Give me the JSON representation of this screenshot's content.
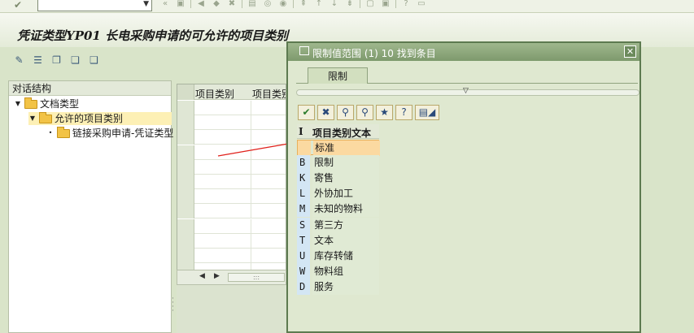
{
  "window": {
    "title": "凭证类型YP01 长电采购申请的可允许的项目类别"
  },
  "toolbar": {
    "command_field_value": "",
    "icons": [
      "check-icon",
      "save-icon",
      "back-icon",
      "exit-icon",
      "cancel-icon",
      "print-icon",
      "find-icon",
      "find-next-icon",
      "first-page-icon",
      "prev-page-icon",
      "next-page-icon",
      "last-page-icon",
      "new-session-icon",
      "shortcut-icon",
      "help-icon",
      "layout-icon"
    ]
  },
  "app_toolbar": {
    "icons": [
      "display-change-icon",
      "new-entries-icon",
      "copy-as-icon",
      "delete-icon",
      "select-all-icon"
    ]
  },
  "tree": {
    "header": "对话结构",
    "nodes": [
      {
        "label": "文档类型",
        "level": 0
      },
      {
        "label": "允许的项目类别",
        "level": 1
      },
      {
        "label": "链接采购申请-凭证类型",
        "level": 2
      }
    ]
  },
  "table": {
    "headers": [
      "项目类别",
      "项目类别"
    ],
    "row_count": 12,
    "scroll_thumb": ":::"
  },
  "popup": {
    "title": "限制值范围 (1)   10 找到条目",
    "close_glyph": "✕",
    "tab_label": "限制",
    "splitter_glyph": "▽",
    "toolbar_icons": [
      "confirm-icon",
      "cancel-icon",
      "find-icon",
      "find-next-icon",
      "favorites-icon",
      "help-icon",
      "print-icon"
    ],
    "list_header": {
      "key": "I",
      "text": "项目类别文本"
    },
    "rows": [
      {
        "key": "",
        "text": "标准",
        "highlighted": true
      },
      {
        "key": "B",
        "text": "限制"
      },
      {
        "key": "K",
        "text": "寄售"
      },
      {
        "key": "L",
        "text": "外协加工"
      },
      {
        "key": "M",
        "text": "未知的物料"
      },
      {
        "key": "S",
        "text": "第三方"
      },
      {
        "key": "T",
        "text": "文本"
      },
      {
        "key": "U",
        "text": "库存转储"
      },
      {
        "key": "W",
        "text": "物料组"
      },
      {
        "key": "D",
        "text": "服务"
      }
    ]
  },
  "colors": {
    "background": "#d9e4c9",
    "popup_title": "#7e9a6d",
    "highlight": "#fbd9a1",
    "key_column": "#d3e6f4",
    "annotation_arrow": "#e0201a"
  }
}
